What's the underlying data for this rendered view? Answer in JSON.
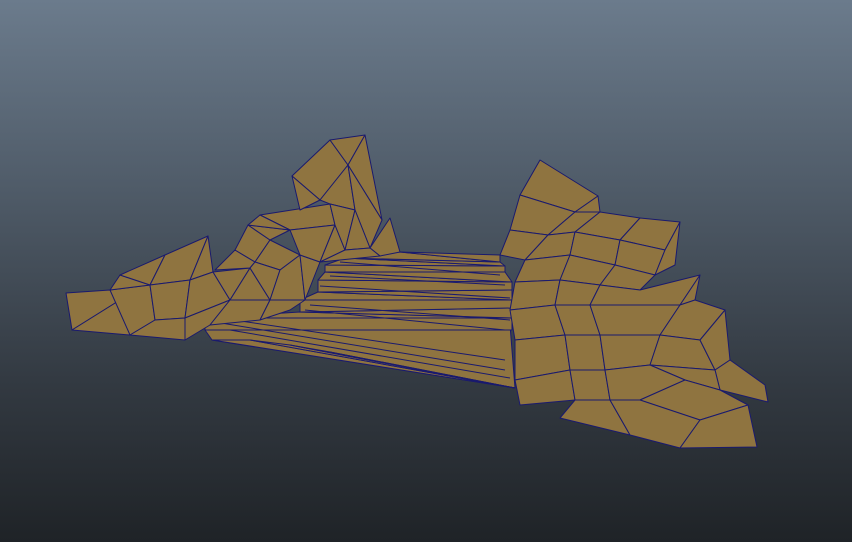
{
  "viewport": {
    "object": "rock-stairs-mesh",
    "display_mode": "wireframe-on-shaded"
  },
  "colors": {
    "background_top": "#6b7b8c",
    "background_bottom": "#1f2327",
    "mesh_face": "#8f7440",
    "mesh_wire": "#1a1a6e"
  }
}
